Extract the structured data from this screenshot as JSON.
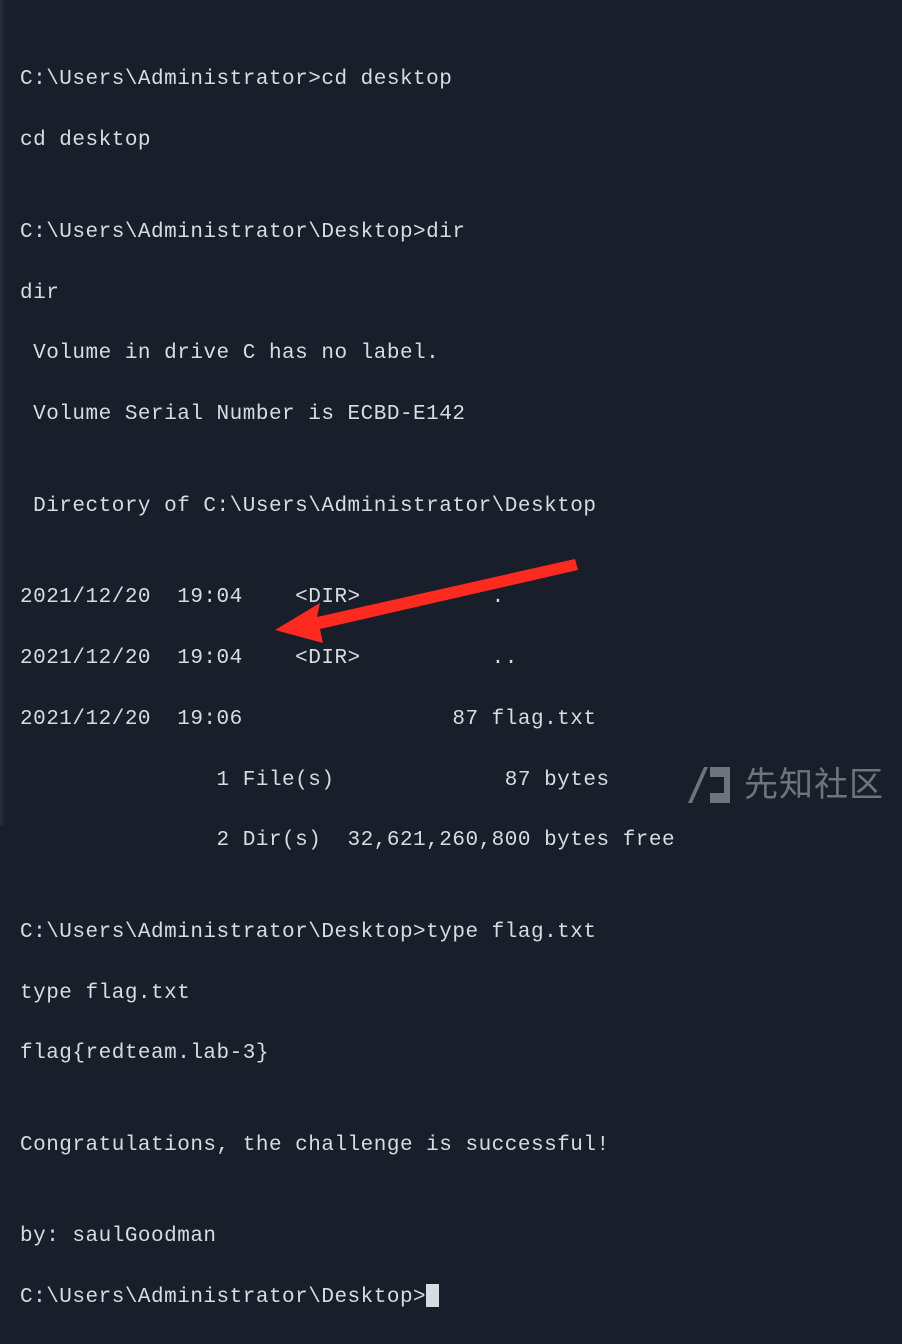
{
  "terminal": {
    "lines": [
      "C:\\Users\\Administrator>cd desktop",
      "cd desktop",
      "",
      "C:\\Users\\Administrator\\Desktop>dir",
      "dir",
      " Volume in drive C has no label.",
      " Volume Serial Number is ECBD-E142",
      "",
      " Directory of C:\\Users\\Administrator\\Desktop",
      "",
      "2021/12/20  19:04    <DIR>          .",
      "2021/12/20  19:04    <DIR>          ..",
      "2021/12/20  19:06                87 flag.txt",
      "               1 File(s)             87 bytes",
      "               2 Dir(s)  32,621,260,800 bytes free",
      "",
      "C:\\Users\\Administrator\\Desktop>type flag.txt",
      "type flag.txt",
      "flag{redteam.lab-3}",
      "",
      "Congratulations, the challenge is successful!",
      "",
      "by: saulGoodman"
    ],
    "final_prompt": "C:\\Users\\Administrator\\Desktop>"
  },
  "watermark": {
    "text": "先知社区"
  },
  "colors": {
    "bg": "#181e2a",
    "fg": "#d8dce0",
    "arrow": "#ff2a1f"
  }
}
